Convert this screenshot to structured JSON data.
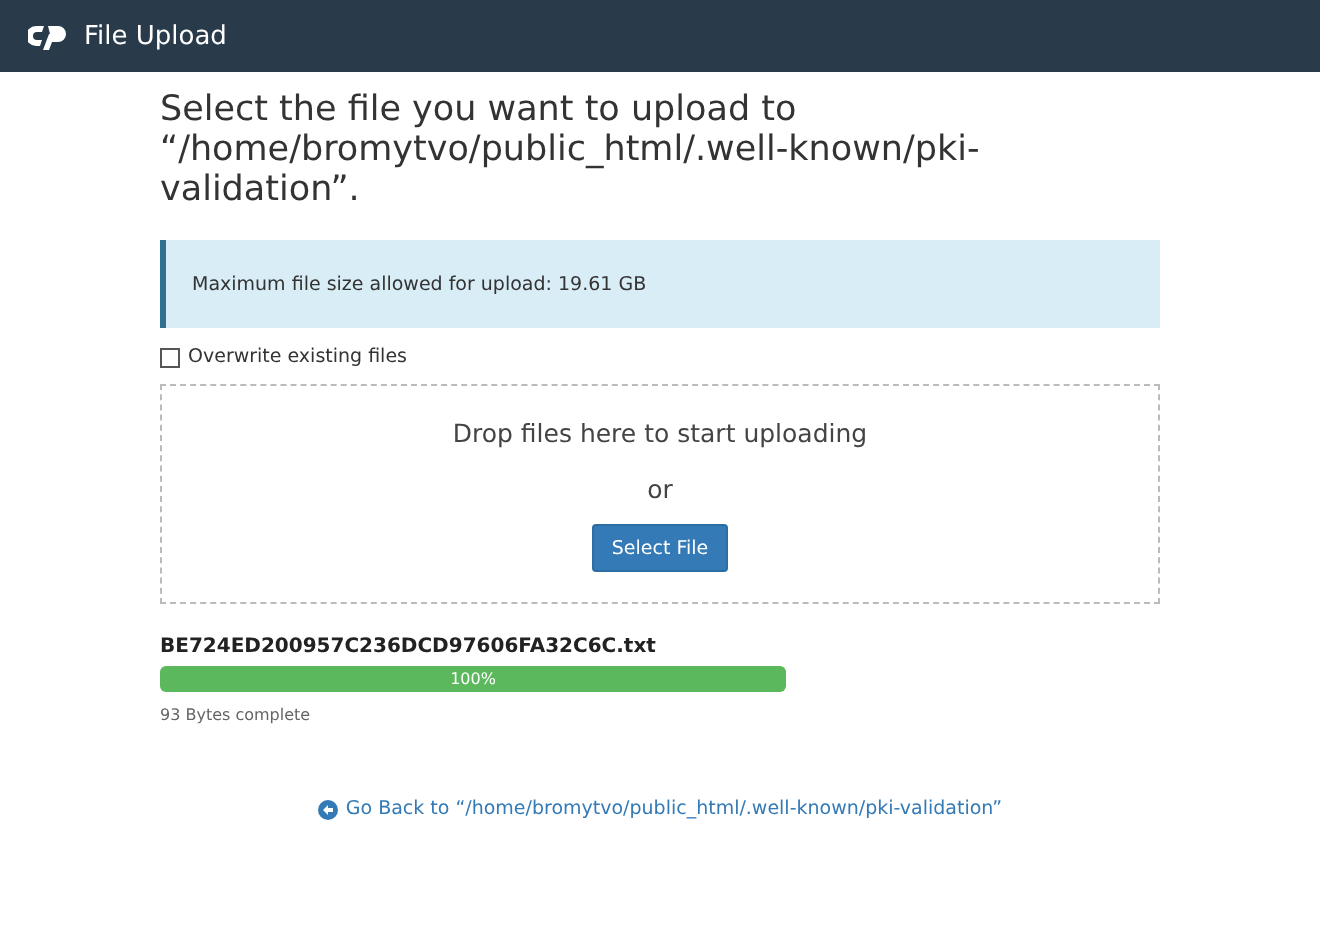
{
  "header": {
    "title": "File Upload"
  },
  "heading": "Select the file you want to upload to “/home/bromytvo/public_html/.well-known/pki-validation”.",
  "notice": "Maximum file size allowed for upload: 19.61 GB",
  "overwrite": {
    "label": "Overwrite existing files",
    "checked": false
  },
  "dropzone": {
    "prompt": "Drop files here to start uploading",
    "or": "or",
    "button": "Select File"
  },
  "uploads": [
    {
      "filename": "BE724ED200957C236DCD97606FA32C6C.txt",
      "level": 1,
      "percent": "100%",
      "status": "93 Bytes complete"
    }
  ],
  "back_link": "Go Back to “/home/bromytvo/public_html/.well-known/pki-validation”"
}
